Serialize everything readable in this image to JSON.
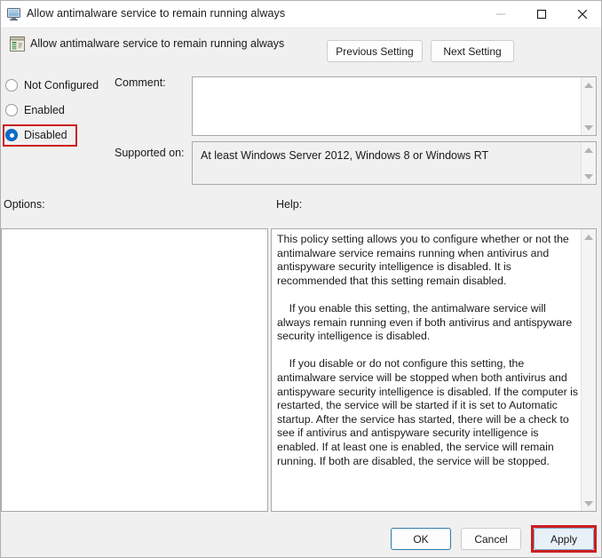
{
  "window": {
    "title": "Allow antimalware service to remain running always",
    "title_icon": "computer-monitor-icon",
    "controls": {
      "minimize": "minimize-icon",
      "maximize": "maximize-icon",
      "close": "close-icon"
    }
  },
  "header": {
    "icon": "group-policy-setting-icon",
    "title": "Allow antimalware service to remain running always",
    "previous_setting_label": "Previous Setting",
    "next_setting_label": "Next Setting"
  },
  "state_options": [
    {
      "label": "Not Configured",
      "selected": false
    },
    {
      "label": "Enabled",
      "selected": false
    },
    {
      "label": "Disabled",
      "selected": true
    }
  ],
  "fields": {
    "comment_label": "Comment:",
    "comment_value": "",
    "supported_on_label": "Supported on:",
    "supported_on_value": "At least Windows Server 2012, Windows 8 or Windows RT"
  },
  "panels": {
    "options_label": "Options:",
    "options_content": "",
    "help_label": "Help:",
    "help_content": "This policy setting allows you to configure whether or not the antimalware service remains running when antivirus and antispyware security intelligence is disabled. It is recommended that this setting remain disabled.\n\n    If you enable this setting, the antimalware service will always remain running even if both antivirus and antispyware security intelligence is disabled.\n\n    If you disable or do not configure this setting, the antimalware service will be stopped when both antivirus and antispyware security intelligence is disabled. If the computer is restarted, the service will be started if it is set to Automatic startup. After the service has started, there will be a check to see if antivirus and antispyware security intelligence is enabled. If at least one is enabled, the service will remain running. If both are disabled, the service will be stopped."
  },
  "footer": {
    "ok_label": "OK",
    "cancel_label": "Cancel",
    "apply_label": "Apply"
  },
  "annotations": {
    "highlight_color": "#cc1f1f",
    "accent_color": "#0b6ec8",
    "highlighted_items": [
      "Disabled",
      "Apply"
    ]
  }
}
